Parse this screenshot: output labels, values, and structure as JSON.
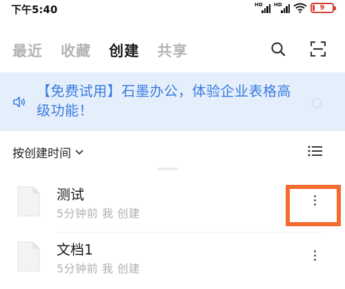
{
  "status_bar": {
    "time": "下午5:40",
    "signal_label_1": "HD",
    "signal_label_2": "HD",
    "battery_level": "9",
    "battery_fraction": 0.09,
    "battery_color": "#d93c2f"
  },
  "tabs": [
    {
      "label": "最近",
      "active": false
    },
    {
      "label": "收藏",
      "active": false
    },
    {
      "label": "创建",
      "active": true
    },
    {
      "label": "共享",
      "active": false
    }
  ],
  "top_actions": {
    "search_icon": "search-icon",
    "scan_icon": "scan-icon"
  },
  "banner": {
    "text": "【免费试用】石墨办公，体验企业表格高级功能！",
    "icon": "speaker-icon",
    "close_icon": "close-icon",
    "background": "#e5eefb",
    "text_color": "#3a7be0"
  },
  "sort": {
    "label": "按创建时间",
    "icon": "chevron-down-icon",
    "view_icon": "list-view-icon"
  },
  "files": [
    {
      "name": "测试",
      "meta": "5分钟前 我 创建",
      "highlighted": true
    },
    {
      "name": "文档1",
      "meta": "5分钟前 我 创建",
      "highlighted": false
    }
  ],
  "highlight_color": "#f36b2d"
}
